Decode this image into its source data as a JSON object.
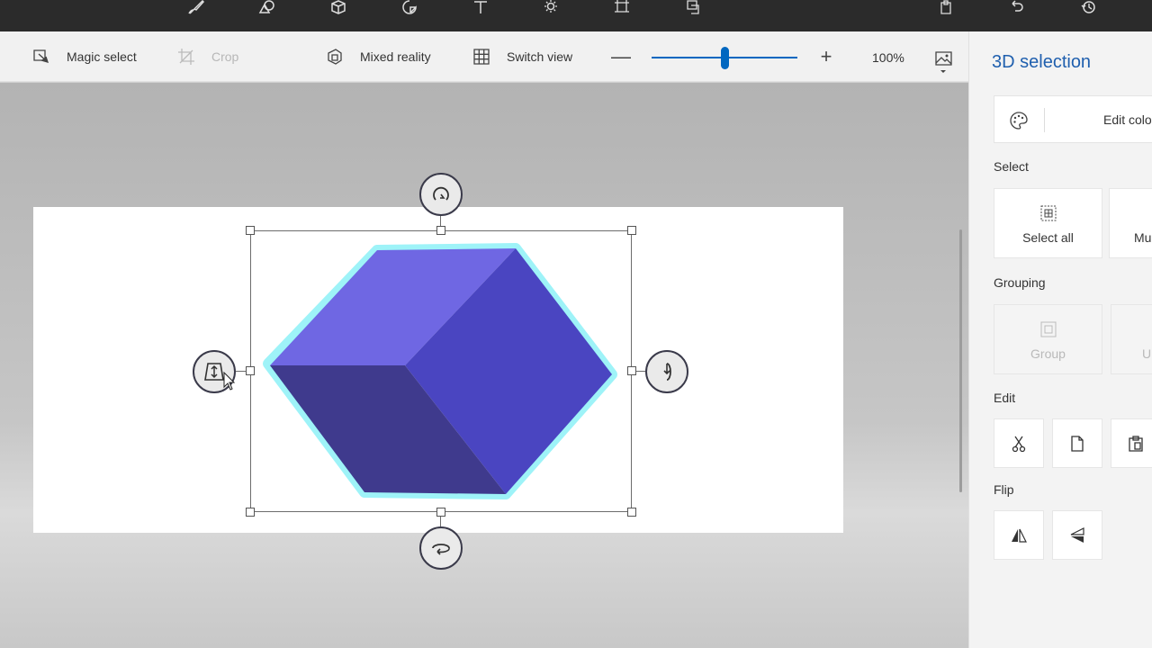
{
  "toolbar": {
    "magic_select_label": "Magic select",
    "crop_label": "Crop",
    "mixed_reality_label": "Mixed reality",
    "switch_view_label": "Switch view",
    "zoom_minus": "—",
    "zoom_plus": "+",
    "zoom_value": "100%",
    "zoom_level_fraction": 0.5
  },
  "top_icons": [
    "brush-icon",
    "2d-shapes-icon",
    "3d-shapes-icon",
    "stickers-icon",
    "text-icon",
    "effects-icon",
    "canvas-icon",
    "3d-library-icon",
    "paste-icon",
    "undo-icon",
    "history-icon"
  ],
  "panel": {
    "title": "3D selection",
    "edit_color_label": "Edit colou",
    "select_label": "Select",
    "select_all_label": "Select all",
    "multi_select_label": "Mu",
    "grouping_label": "Grouping",
    "group_label": "Group",
    "ungroup_label": "U",
    "edit_label": "Edit",
    "flip_label": "Flip"
  },
  "colors": {
    "accent": "#1f5fae",
    "slider": "#0067c0",
    "cube_top": "#6f67e3",
    "cube_right": "#4a45c1",
    "cube_left": "#3f3a8d",
    "cube_glow": "#9ef3f8",
    "topbar": "#2b2b2b"
  }
}
